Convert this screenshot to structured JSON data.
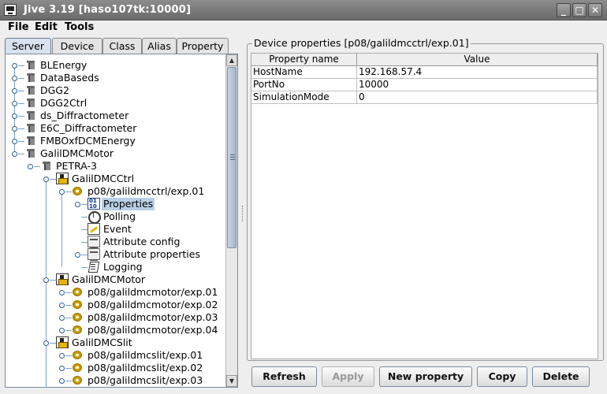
{
  "window": {
    "title": "Jive 3.19  [haso107tk:10000]",
    "minimize": "_",
    "maximize": "□",
    "close": "✕"
  },
  "menu": [
    "File",
    "Edit",
    "Tools"
  ],
  "tabs": [
    "Server",
    "Device",
    "Class",
    "Alias",
    "Property"
  ],
  "active_tab": "Server",
  "tree": {
    "servers": [
      "BLEnergy",
      "DataBaseds",
      "DGG2",
      "DGG2Ctrl",
      "ds_Diffractometer",
      "E6C_Diffractometer",
      "FMBOxfDCMEnergy",
      "GalilDMCMotor"
    ],
    "instance": "PETRA-3",
    "classes": [
      "GalilDMCCtrl",
      "GalilDMCMotor",
      "GalilDMCSlit"
    ],
    "ctrl_device": "p08/galildmcctrl/exp.01",
    "device_children": [
      "Properties",
      "Polling",
      "Event",
      "Attribute config",
      "Attribute properties",
      "Logging"
    ],
    "motor_devices": [
      "p08/galildmcmotor/exp.01",
      "p08/galildmcmotor/exp.02",
      "p08/galildmcmotor/exp.03",
      "p08/galildmcmotor/exp.04"
    ],
    "slit_devices": [
      "p08/galildmcslit/exp.01",
      "p08/galildmcslit/exp.02",
      "p08/galildmcslit/exp.03"
    ],
    "selected": "Properties"
  },
  "properties_panel": {
    "title": "Device properties [p08/galildmcctrl/exp.01]",
    "columns": [
      "Property name",
      "Value"
    ],
    "rows": [
      [
        "HostName",
        "192.168.57.4"
      ],
      [
        "PortNo",
        "10000"
      ],
      [
        "SimulationMode",
        "0"
      ]
    ]
  },
  "buttons": {
    "refresh": "Refresh",
    "apply": "Apply",
    "new_property": "New property",
    "copy": "Copy",
    "delete": "Delete"
  },
  "scroll_arrows": {
    "up": "▲",
    "down": "▼"
  }
}
